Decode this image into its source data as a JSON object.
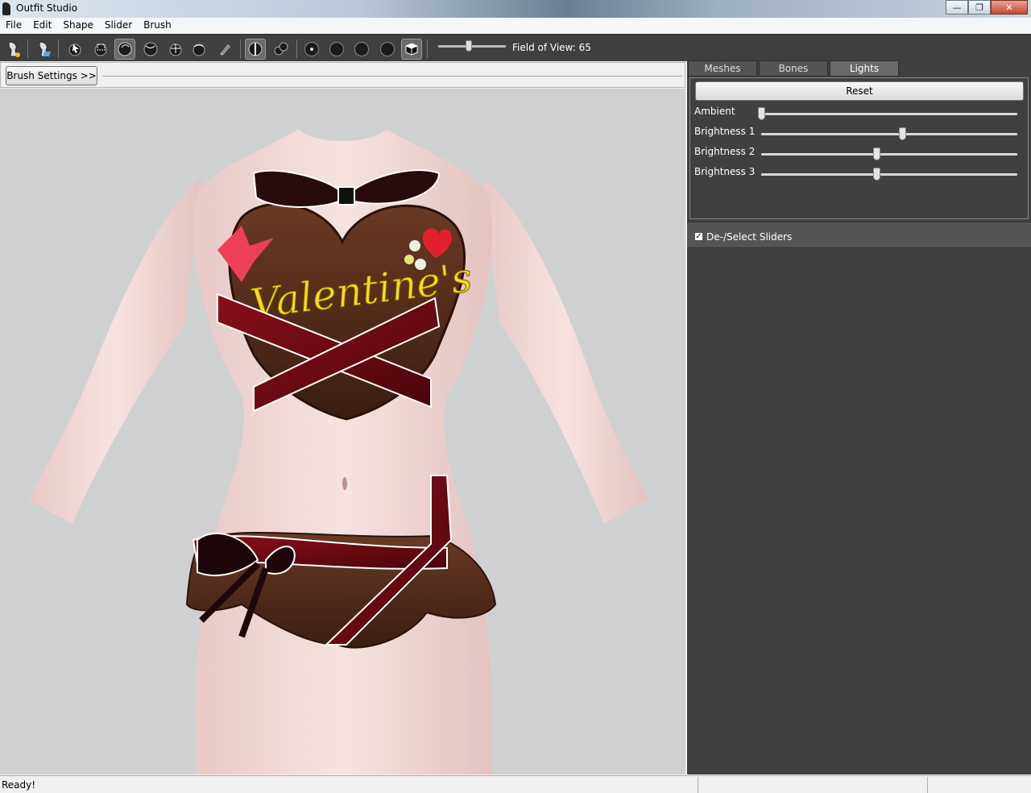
{
  "window": {
    "title": "Outfit Studio"
  },
  "menu": [
    "File",
    "Edit",
    "Shape",
    "Slider",
    "Brush"
  ],
  "toolbar": {
    "tools": [
      {
        "name": "new-project-icon"
      },
      {
        "name": "load-outfit-icon"
      },
      {
        "name": "select-brush-icon"
      },
      {
        "name": "mask-brush-icon"
      },
      {
        "name": "inflate-brush-icon"
      },
      {
        "name": "deflate-brush-icon"
      },
      {
        "name": "move-brush-icon"
      },
      {
        "name": "smooth-brush-icon"
      },
      {
        "name": "weight-brush-icon"
      },
      {
        "name": "mirror-x-icon"
      },
      {
        "name": "connected-only-icon"
      },
      {
        "name": "shade-icon"
      },
      {
        "name": "wireframe-icon"
      },
      {
        "name": "texture-icon"
      },
      {
        "name": "lighting-icon"
      },
      {
        "name": "cube-icon"
      }
    ],
    "fov_label": "Field of View: 65",
    "fov_value": 65
  },
  "brush_settings_label": "Brush Settings >>",
  "tabs": [
    {
      "label": "Meshes",
      "active": false
    },
    {
      "label": "Bones",
      "active": false
    },
    {
      "label": "Lights",
      "active": true
    }
  ],
  "lights": {
    "reset_label": "Reset",
    "rows": [
      {
        "label": "Ambient",
        "value": 0.0
      },
      {
        "label": "Brightness 1",
        "value": 0.55
      },
      {
        "label": "Brightness 2",
        "value": 0.45
      },
      {
        "label": "Brightness 3",
        "value": 0.45
      }
    ]
  },
  "sliders": {
    "label": "De-/Select Sliders",
    "checked": true
  },
  "viewport": {
    "text": "Valentine's"
  },
  "status": {
    "text": "Ready!"
  }
}
